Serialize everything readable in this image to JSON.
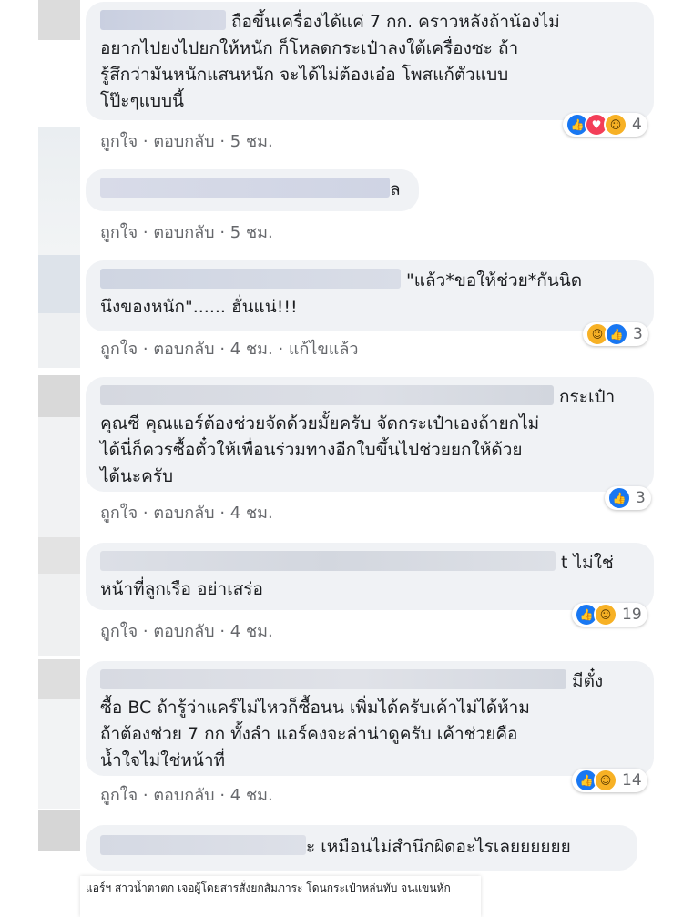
{
  "actions": {
    "like": "ถูกใจ",
    "reply": "ตอบกลับ",
    "sep": " · ",
    "edited": "แก้ไขแล้ว"
  },
  "comments": [
    {
      "lines": [
        "ถือขึ้นเครื่องได้แค่ 7 กก. คราวหลังถ้าน้องไม่",
        "อยากไปยงไปยกให้หนัก ก็โหลดกระเป๋าลงใต้เครื่องซะ ถ้า",
        "รู้สึกว่ามันหนักแสนหนัก จะได้ไม่ต้องเอ๋อ โพสแก้ตัวแบบ",
        "โป๊ะๆแบบนี้"
      ],
      "time": "5 ชม.",
      "reactions": [
        "like",
        "love",
        "haha"
      ],
      "count": "4"
    },
    {
      "lines": [
        "ล"
      ],
      "time": "5 ชม.",
      "reactions": [],
      "count": ""
    },
    {
      "lines": [
        "\"แล้ว*ขอให้ช่วย*กันนิด",
        "นึงของหนัก\"...... ฮั่นแน่!!!"
      ],
      "time": "4 ชม.",
      "reactions": [
        "haha",
        "like"
      ],
      "count": "3"
    },
    {
      "lines": [
        "กระเป๋า",
        "คุณซี คุณแอร์ต้องช่วยจัดด้วยมั้ยครับ จัดกระเป๋าเองถ้ายกไม่",
        "ได้นี่ก็ควรซื้อตั๋วให้เพื่อนร่วมทางอีกใบขึ้นไปช่วยยกให้ด้วย",
        "ได้นะครับ"
      ],
      "time": "4 ชม.",
      "reactions": [
        "like"
      ],
      "count": "3"
    },
    {
      "lines": [
        "t ไม่ใช่",
        "หน้าที่ลูกเรือ อย่าเสร่อ"
      ],
      "time": "4 ชม.",
      "reactions": [
        "like",
        "haha"
      ],
      "count": "19"
    },
    {
      "lines": [
        "มีตั๋ง",
        "ซื้อ BC ถ้ารู้ว่าแคร์ไม่ไหวก็ซื้อนน เพิ่มได้ครับเค้าไม่ได้ห้าม",
        "ถ้าต้องช่วย 7 กก ทั้งลำ แอร์คงจะล่าน่าดูครับ เค้าช่วยคือ",
        "น้ำใจไม่ใช่หน้าที่"
      ],
      "time": "4 ชม.",
      "reactions": [
        "like",
        "haha"
      ],
      "count": "14"
    },
    {
      "lines": [
        "ะ เหมือนไม่สำนึกผิดอะไรเลยยยยยย"
      ],
      "time": "",
      "reactions": [],
      "count": ""
    }
  ],
  "caption": "แอร์ฯ สาวน้ำตาตก เจอผู้โดยสารสั่งยกสัมภาระ โดนกระเป๋าหล่นทับ จนแขนหัก",
  "colors": {
    "bubble": "#f0f2f5",
    "meta": "#65676b",
    "like": "#1877f2",
    "love": "#f33e58",
    "haha": "#f7b125"
  },
  "icons": {
    "like": "thumbs-up-icon",
    "love": "heart-icon",
    "haha": "laughing-face-icon"
  }
}
